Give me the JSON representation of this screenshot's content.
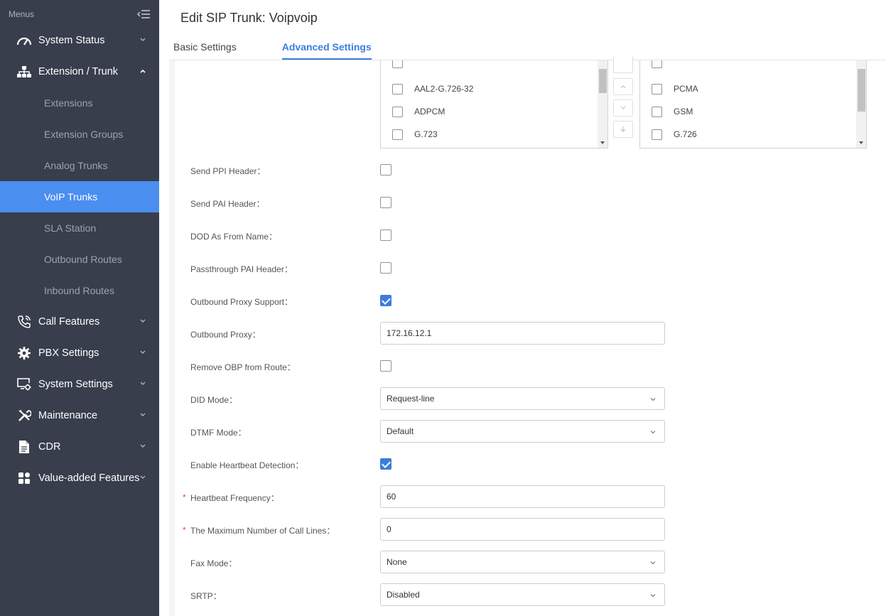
{
  "sidebar": {
    "menus_label": "Menus",
    "items": [
      {
        "label": "System Status",
        "icon": "gauge-icon"
      },
      {
        "label": "Extension / Trunk",
        "icon": "network-icon"
      },
      {
        "label": "Call Features",
        "icon": "phone-icon"
      },
      {
        "label": "PBX Settings",
        "icon": "gear-icon"
      },
      {
        "label": "System Settings",
        "icon": "monitor-gear-icon"
      },
      {
        "label": "Maintenance",
        "icon": "tools-icon"
      },
      {
        "label": "CDR",
        "icon": "document-icon"
      },
      {
        "label": "Value-added Features",
        "icon": "grid-icon"
      }
    ],
    "sub_items": [
      "Extensions",
      "Extension Groups",
      "Analog Trunks",
      "VoIP Trunks",
      "SLA Station",
      "Outbound Routes",
      "Inbound Routes"
    ],
    "active_sub_item": "VoIP Trunks"
  },
  "header": {
    "title": "Edit SIP Trunk: Voipvoip",
    "tabs": [
      "Basic Settings",
      "Advanced Settings"
    ],
    "active_tab": "Advanced Settings"
  },
  "codecs": {
    "available": [
      "AAL2-G.726-32",
      "ADPCM",
      "G.723"
    ],
    "selected": [
      "PCMA",
      "GSM",
      "G.726"
    ]
  },
  "form": {
    "send_ppi_header": {
      "label": "Send PPI Header：",
      "checked": false
    },
    "send_pai_header": {
      "label": "Send PAI Header：",
      "checked": false
    },
    "dod_as_from_name": {
      "label": "DOD As From Name：",
      "checked": false
    },
    "passthrough_pai_header": {
      "label": "Passthrough PAI Header：",
      "checked": false
    },
    "outbound_proxy_support": {
      "label": "Outbound Proxy Support：",
      "checked": true
    },
    "outbound_proxy": {
      "label": "Outbound Proxy：",
      "value": "172.16.12.1"
    },
    "remove_obp_from_route": {
      "label": "Remove OBP from Route：",
      "checked": false
    },
    "did_mode": {
      "label": "DID Mode：",
      "value": "Request-line"
    },
    "dtmf_mode": {
      "label": "DTMF Mode：",
      "value": "Default"
    },
    "enable_heartbeat_detection": {
      "label": "Enable Heartbeat Detection：",
      "checked": true
    },
    "heartbeat_frequency": {
      "label": "Heartbeat Frequency：",
      "value": "60",
      "required": "*"
    },
    "max_call_lines": {
      "label": "The Maximum Number of Call Lines：",
      "value": "0",
      "required": "*"
    },
    "fax_mode": {
      "label": "Fax Mode：",
      "value": "None"
    },
    "srtp": {
      "label": "SRTP：",
      "value": "Disabled"
    }
  },
  "colors": {
    "sidebar_bg": "#383e4c",
    "active_item": "#4a8ef0",
    "accent": "#3b7ddd",
    "required": "#e2473f"
  }
}
